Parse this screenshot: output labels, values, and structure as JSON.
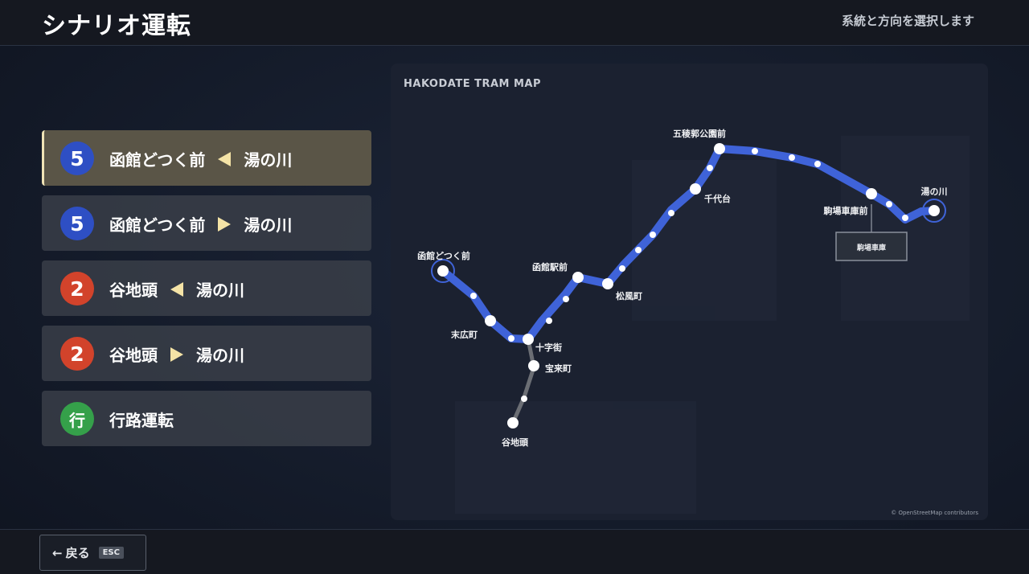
{
  "header": {
    "title": "シナリオ運転",
    "subtitle": "系統と方向を選択します"
  },
  "menu": {
    "items": [
      {
        "badge": "5",
        "badge_color": "#2e4fc4",
        "from": "函館どつく前",
        "direction": "left",
        "to": "湯の川",
        "selected": true
      },
      {
        "badge": "5",
        "badge_color": "#2e4fc4",
        "from": "函館どつく前",
        "direction": "right",
        "to": "湯の川",
        "selected": false
      },
      {
        "badge": "2",
        "badge_color": "#d2432b",
        "from": "谷地頭",
        "direction": "left",
        "to": "湯の川",
        "selected": false
      },
      {
        "badge": "2",
        "badge_color": "#d2432b",
        "from": "谷地頭",
        "direction": "right",
        "to": "湯の川",
        "selected": false
      },
      {
        "badge": "行",
        "badge_color": "#35a04a",
        "label": "行路運転",
        "selected": false
      }
    ]
  },
  "map": {
    "title": "HAKODATE TRAM MAP",
    "credit": "© OpenStreetMap contributors",
    "depot_label": "駒場車庫",
    "line_colors": {
      "main": "#3f63d8",
      "branch": "#6b6e74"
    },
    "stations": {
      "dock": "函館どつく前",
      "suehiro": "末広町",
      "jujigai": "十字街",
      "horaicho": "宝来町",
      "yachigashira": "谷地頭",
      "hakodate_ekimae": "函館駅前",
      "matsukaze": "松風町",
      "chiyogadai": "千代台",
      "goryokaku": "五稜郭公園前",
      "komaba": "駒場車庫前",
      "yunokawa": "湯の川"
    }
  },
  "footer": {
    "back_label": "戻る",
    "back_arrow": "←",
    "key": "ESC"
  }
}
